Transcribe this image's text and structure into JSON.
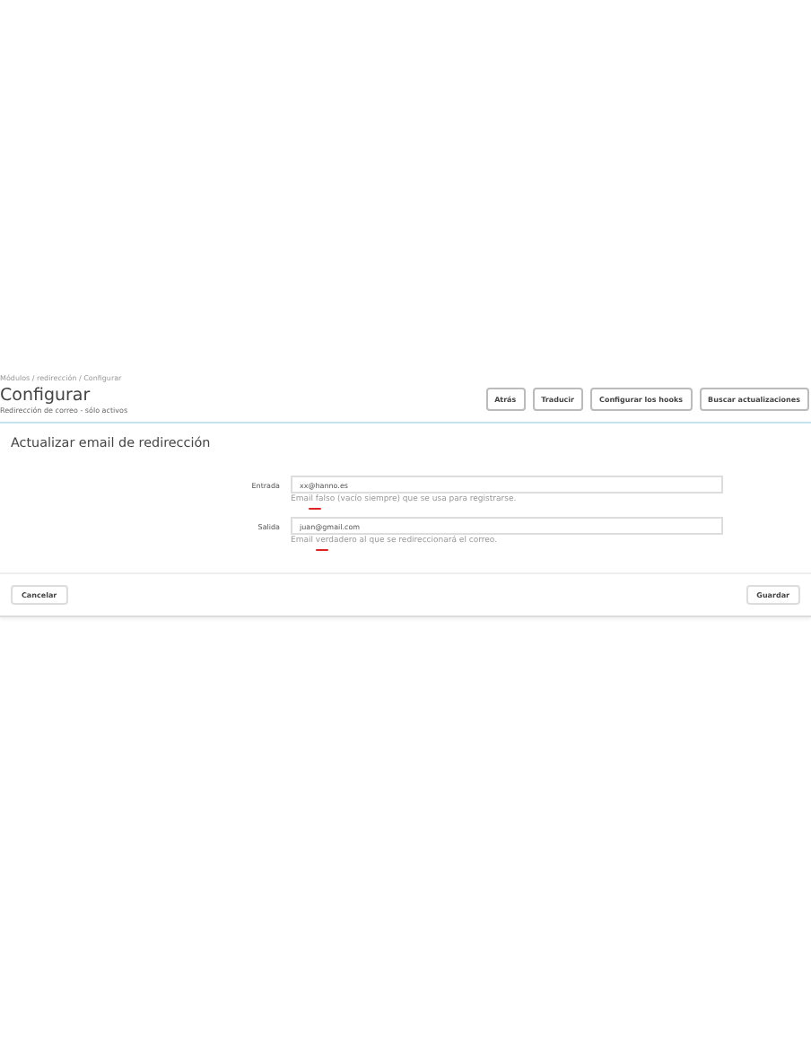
{
  "breadcrumb": "Módulos / redirección / Configurar",
  "header": {
    "title": "Configurar",
    "subtitle": "Redirección de correo - sólo activos"
  },
  "toolbar": [
    "Atrás",
    "Traducir",
    "Configurar los hooks",
    "Buscar actualizaciones"
  ],
  "panel": {
    "title": "Actualizar email de redirección",
    "fields": [
      {
        "label": "Entrada",
        "value": "xx@hanno.es",
        "hint": "Email falso (vacío siempre) que se usa para registrarse."
      },
      {
        "label": "Salida",
        "value": "juan@gmail.com",
        "hint": "Email verdadero al que se redireccionará el correo."
      }
    ],
    "buttons": [
      "Cancelar",
      "Guardar"
    ]
  }
}
